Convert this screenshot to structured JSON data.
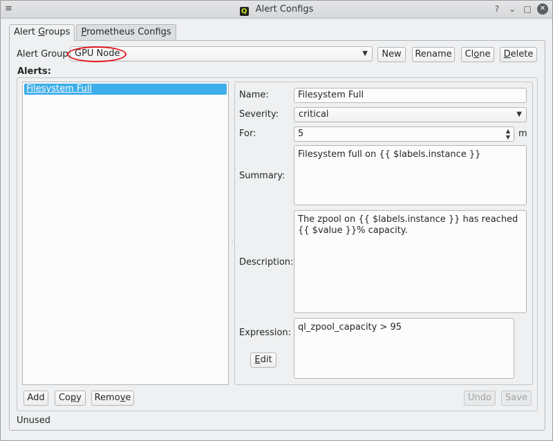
{
  "window": {
    "title": "Alert Configs",
    "app_icon_glyph": "Q",
    "controls": {
      "help": "?",
      "minimize": "⌄",
      "maximize": "□",
      "close": "✕"
    },
    "menu_glyph": "≡"
  },
  "tabs": [
    {
      "label_pre": "Alert ",
      "label_u": "G",
      "label_post": "roups"
    },
    {
      "label_pre": "",
      "label_u": "P",
      "label_post": "rometheus Configs"
    }
  ],
  "group_row": {
    "label": "Alert Group:",
    "selected": "GPU Node",
    "buttons": {
      "new": "New",
      "rename": "Rename",
      "clone": {
        "pre": "Cl",
        "u": "o",
        "post": "ne"
      },
      "delete": {
        "pre": "",
        "u": "D",
        "post": "elete"
      }
    }
  },
  "alerts_label": "Alerts:",
  "alerts_list": [
    "Filesystem Full"
  ],
  "form": {
    "name_label": "Name:",
    "name_value": "Filesystem Full",
    "severity_label": "Severity:",
    "severity_value": "critical",
    "for_label": "For:",
    "for_value": "5",
    "for_unit": "m",
    "summary_label": "Summary:",
    "summary_value": "Filesystem full on {{ $labels.instance }}",
    "description_label": "Description:",
    "description_value": "The zpool on {{ $labels.instance }} has reached {{ $value }}% capacity.",
    "expression_label": "Expression:",
    "expression_value": "ql_zpool_capacity > 95",
    "edit_button": {
      "pre": "",
      "u": "E",
      "post": "dit"
    }
  },
  "list_buttons": {
    "add": "Add",
    "copy": {
      "pre": "Co",
      "u": "p",
      "post": "y"
    },
    "remove": {
      "pre": "Remo",
      "u": "v",
      "post": "e"
    }
  },
  "form_buttons": {
    "undo": "Undo",
    "save": "Save"
  },
  "status": "Unused",
  "colors": {
    "selection": "#3daee9",
    "highlight_ring": "#e4141b",
    "window_bg": "#eff0f1"
  }
}
